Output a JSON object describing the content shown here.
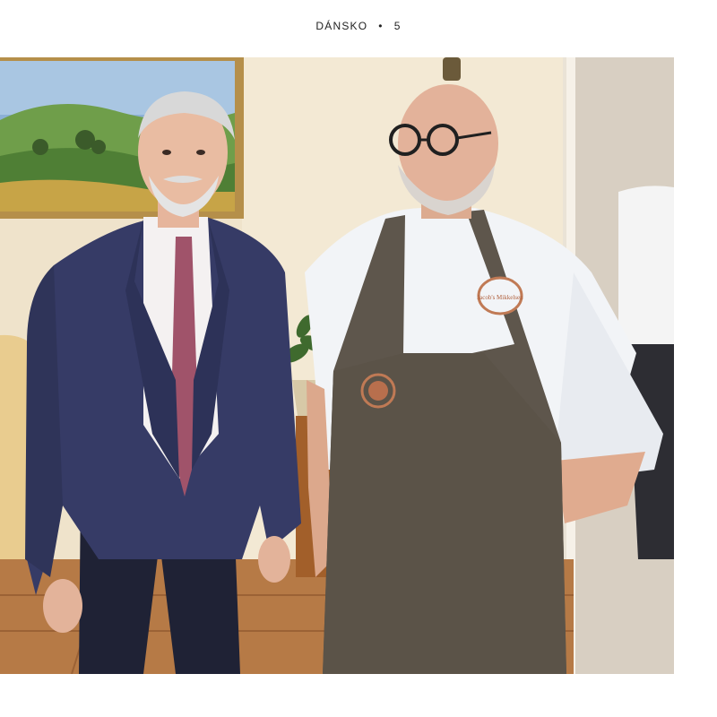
{
  "header": {
    "section": "DÁNSKO",
    "separator": "•",
    "page_number": "5"
  },
  "photo": {
    "chef_badge_text": "Jacob's Mikkelsen"
  },
  "colors": {
    "wall": "#f1e6cf",
    "suit": "#353a63",
    "tie": "#a0536a",
    "chef_jacket": "#f2f4f7",
    "apron": "#5e564c",
    "badge": "#c07a55",
    "floor": "#b77c47"
  }
}
